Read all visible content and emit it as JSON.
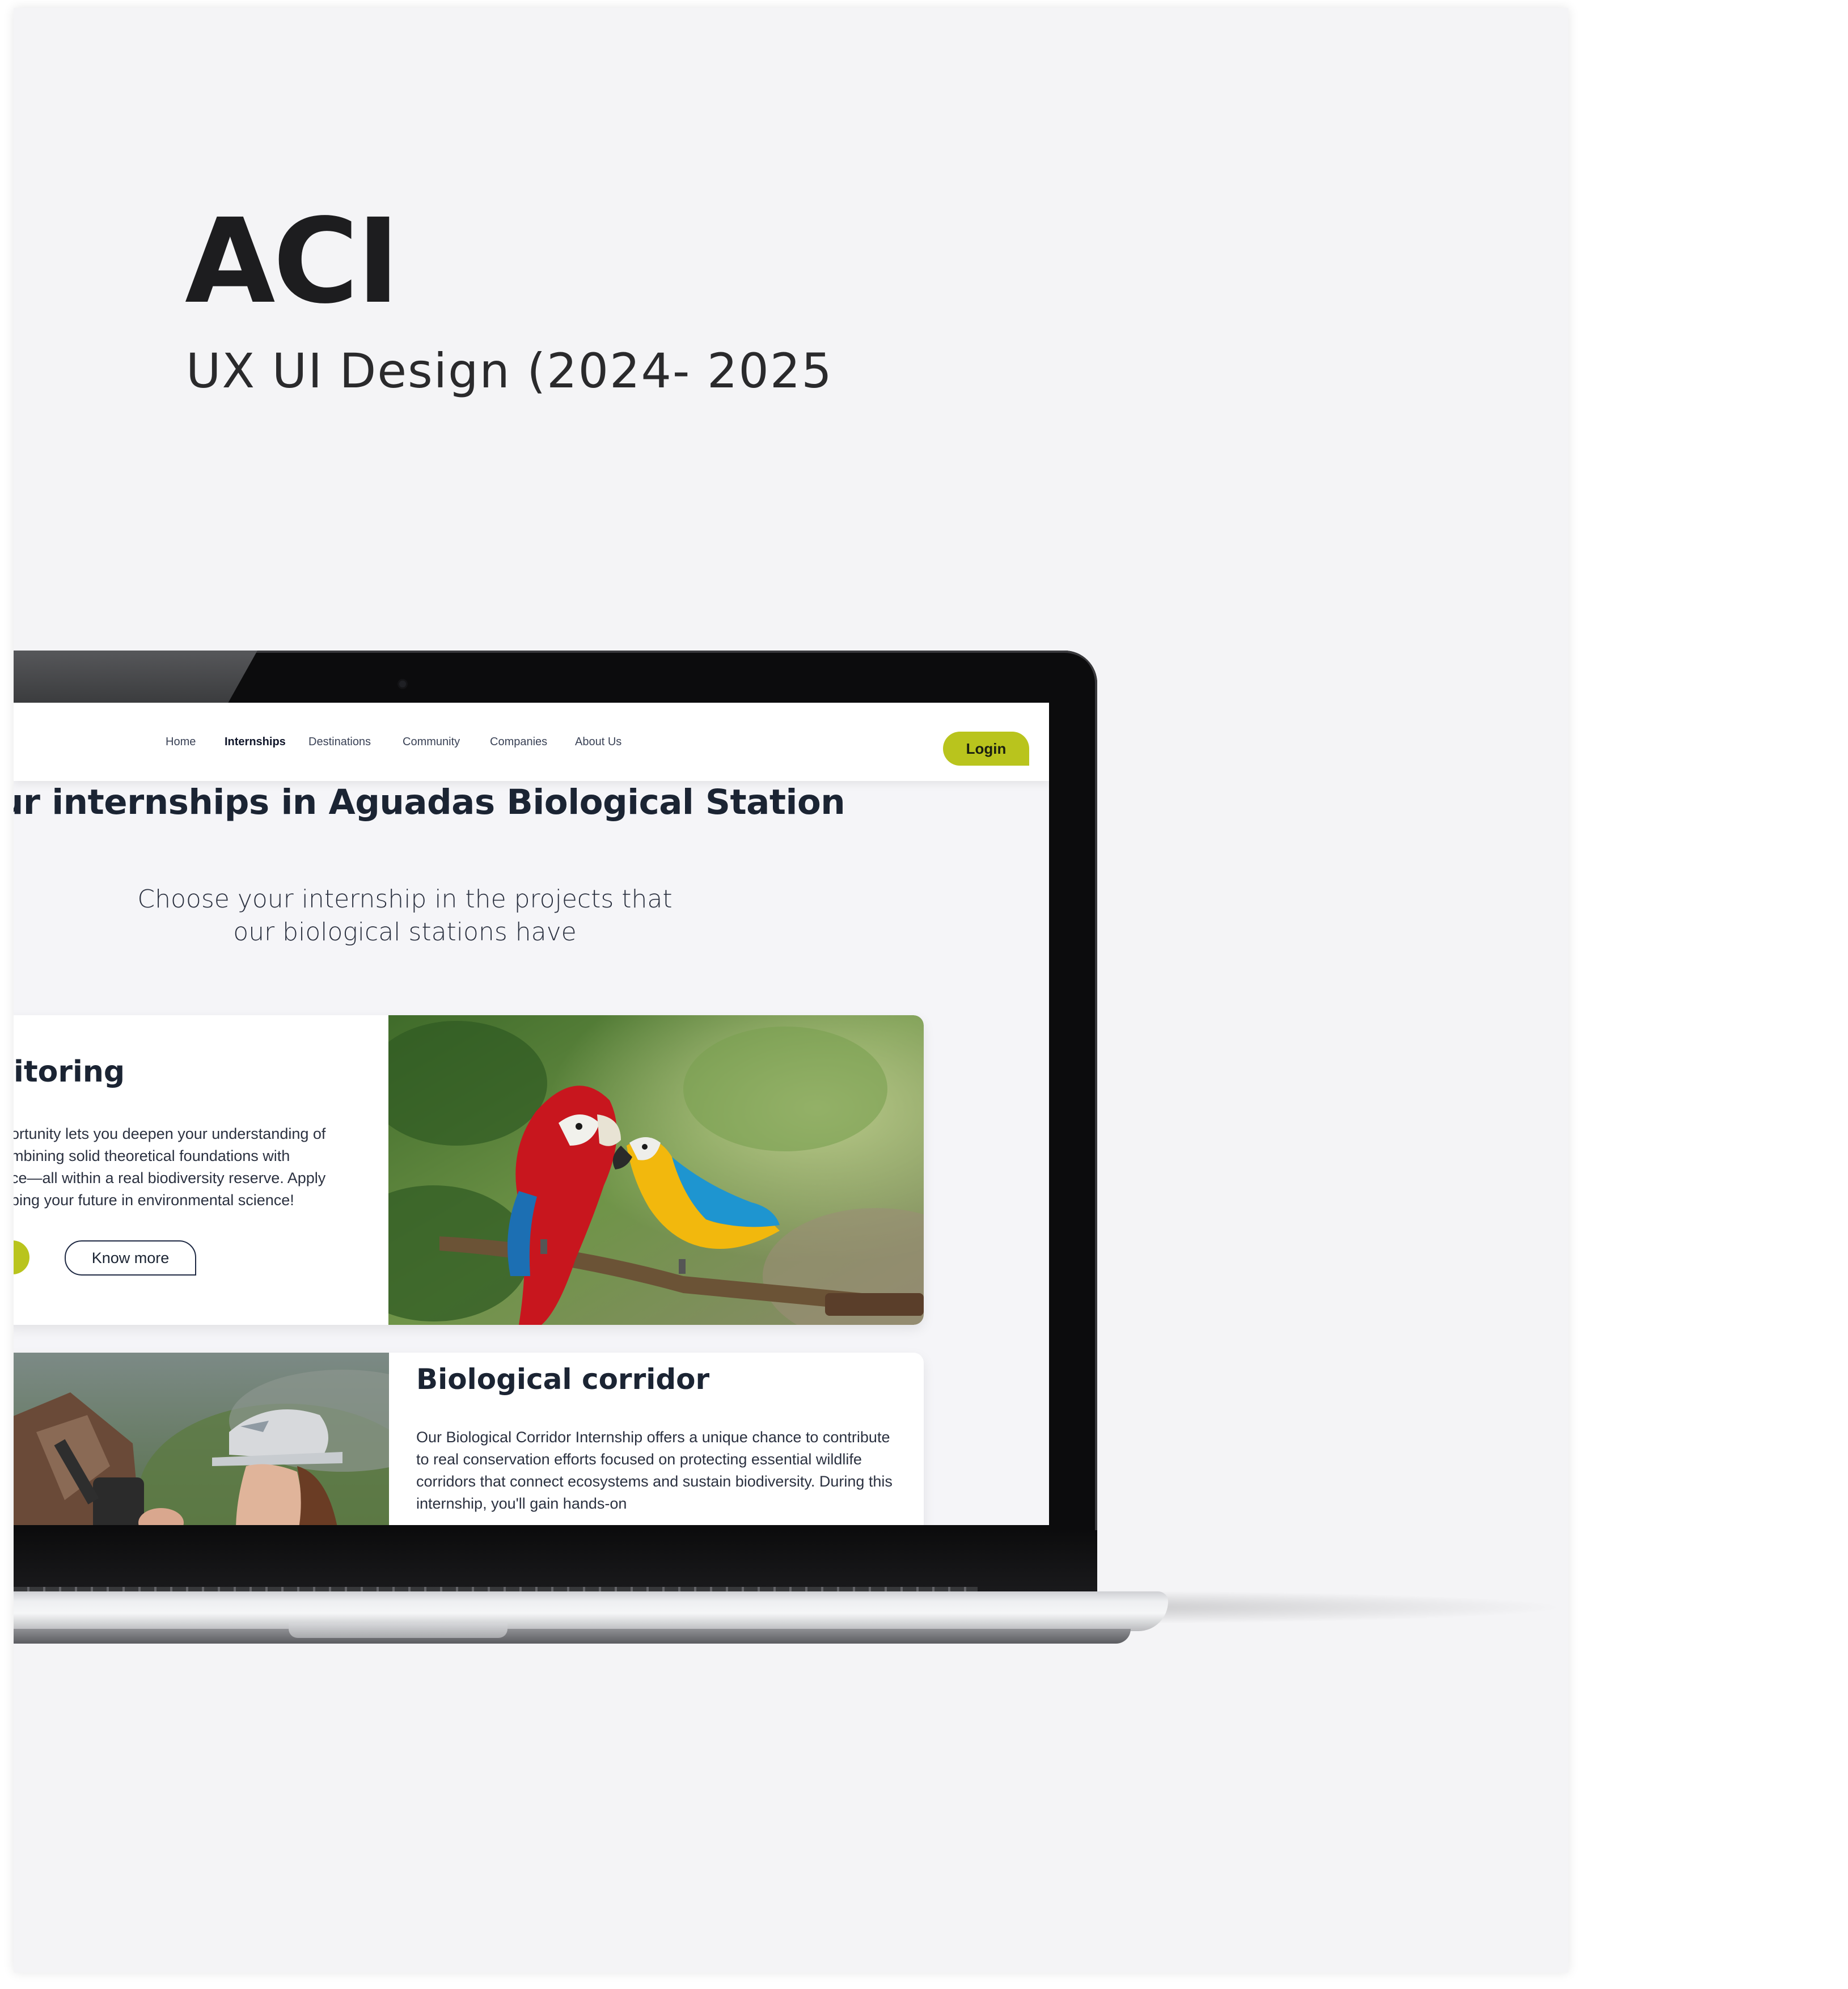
{
  "project": {
    "title": "ACI",
    "subtitle": "UX UI Design (2024- 2025"
  },
  "site": {
    "nav": {
      "items": [
        {
          "label": "Home",
          "active": false
        },
        {
          "label": "Internships",
          "active": true
        },
        {
          "label": "Destinations",
          "active": false
        },
        {
          "label": "Community",
          "active": false
        },
        {
          "label": "Companies",
          "active": false
        },
        {
          "label": "About Us",
          "active": false
        }
      ],
      "login_label": "Login"
    },
    "hero": {
      "title": "ur internships in Aguadas Biological Station",
      "subtitle": "Choose your internship in the projects that our biological stations have"
    },
    "cards": [
      {
        "title": "itoring",
        "text": "portunity lets you deepen your understanding of\nombining solid theoretical foundations with\nnce—all within a real biodiversity reserve. Apply\naping your future in environmental science!",
        "secondary_button": "Know more",
        "image": "macaw-parrots-photo"
      },
      {
        "title": "Biological corridor",
        "text": "Our Biological Corridor Internship offers a unique chance to contribute to real conservation efforts focused on protecting essential wildlife corridors that connect ecosystems and sustain biodiversity. During this internship, you'll gain hands-on",
        "image": "field-researcher-photo"
      }
    ]
  },
  "colors": {
    "accent": "#b9c41d",
    "heading": "#1b2433",
    "sheet_bg": "#f4f4f6"
  }
}
